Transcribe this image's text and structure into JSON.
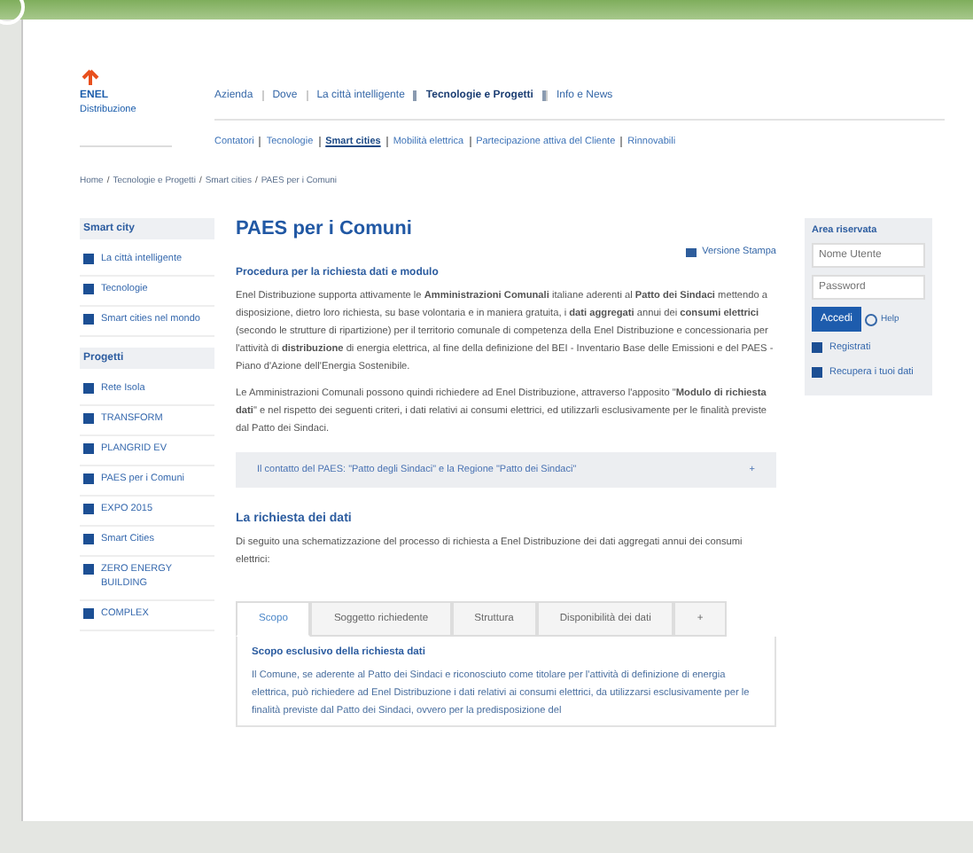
{
  "logo": {
    "brand": "ENEL",
    "name": "Distribuzione"
  },
  "top_nav": [
    {
      "label": "Azienda",
      "selected": false
    },
    {
      "label": "Dove",
      "selected": false
    },
    {
      "label": "La città intelligente",
      "selected": false
    },
    {
      "label": "Tecnologie e Progetti",
      "selected": true
    },
    {
      "label": "Info e News",
      "selected": false
    }
  ],
  "sub_nav": [
    {
      "label": "Contatori",
      "selected": false
    },
    {
      "label": "Tecnologie",
      "selected": false
    },
    {
      "label": "Smart cities",
      "selected": true
    },
    {
      "label": "Mobilità elettrica",
      "selected": false
    },
    {
      "label": "Partecipazione attiva del Cliente",
      "selected": false
    },
    {
      "label": "Rinnovabili",
      "selected": false
    }
  ],
  "breadcrumb": [
    "Home",
    "Tecnologie e Progetti",
    "Smart cities",
    "PAES per i Comuni"
  ],
  "breadcrumb_separator": "/",
  "sidebar": [
    {
      "title": "Smart city",
      "items": [
        {
          "label": "La città intelligente"
        },
        {
          "label": "Tecnologie"
        },
        {
          "label": "Smart cities nel mondo"
        }
      ]
    },
    {
      "title": "Progetti",
      "items": [
        {
          "label": "Rete Isola"
        },
        {
          "label": "TRANSFORM"
        },
        {
          "label": "PLANGRID EV"
        },
        {
          "label": "PAES per i Comuni"
        },
        {
          "label": "EXPO 2015"
        },
        {
          "label": "Smart Cities"
        },
        {
          "label": "ZERO ENERGY BUILDING"
        },
        {
          "label": "COMPLEX"
        }
      ]
    }
  ],
  "main": {
    "title": "PAES per i Comuni",
    "print_link": "Versione Stampa",
    "section_heading": "Procedura per la richiesta dati e modulo",
    "paragraphs": [
      "Enel Distribuzione supporta attivamente le **Amministrazioni Comunali** italiane aderenti al **Patto dei Sindaci** mettendo a disposizione, dietro loro richiesta, su base volontaria e in maniera gratuita, i **dati aggregati** annui dei **consumi elettrici** (secondo le strutture di ripartizione) per il territorio comunale di competenza della Enel Distribuzione e concessionaria per l'attività di **distribuzione** di energia elettrica, al fine della definizione del BEI - Inventario Base delle Emissioni e del PAES - Piano d'Azione dell'Energia Sostenibile.",
      "Le Amministrazioni Comunali possono quindi richiedere ad Enel Distribuzione, attraverso l'apposito \"**Modulo di richiesta dati**\" e nel rispetto dei seguenti criteri, i dati relativi ai consumi elettrici, ed utilizzarli esclusivamente per le finalità previste dal Patto dei Sindaci."
    ],
    "accordion": {
      "label": "Il contatto del PAES: \"Patto degli Sindaci\" e la Regione \"Patto dei Sindaci\"",
      "expanded": false,
      "toggle": "+"
    },
    "request_heading": "La richiesta dei dati",
    "request_text": "Di seguito una schematizzazione del processo di richiesta a Enel Distribuzione dei dati aggregati annui dei consumi elettrici:",
    "tabs": [
      {
        "label": "Scopo",
        "selected": true
      },
      {
        "label": "Soggetto richiedente",
        "selected": false
      },
      {
        "label": "Struttura",
        "selected": false
      },
      {
        "label": "Disponibilità dei dati",
        "selected": false
      },
      {
        "label": "+",
        "selected": false
      }
    ],
    "tab_heading": "Scopo esclusivo della richiesta dati",
    "tab_text": "Il Comune, se aderente al Patto dei Sindaci e riconosciuto come titolare per l'attività di definizione di energia elettrica, può richiedere ad Enel Distribuzione i dati relativi ai consumi elettrici, da utilizzarsi esclusivamente per le finalità previste dal Patto dei Sindaci, ovvero per la predisposizione del"
  },
  "login": {
    "title": "Area riservata",
    "username_placeholder": "Nome Utente",
    "password_placeholder": "Password",
    "submit": "Accedi",
    "help": "Help",
    "links": [
      "Registrati",
      "Recupera i tuoi dati"
    ]
  }
}
